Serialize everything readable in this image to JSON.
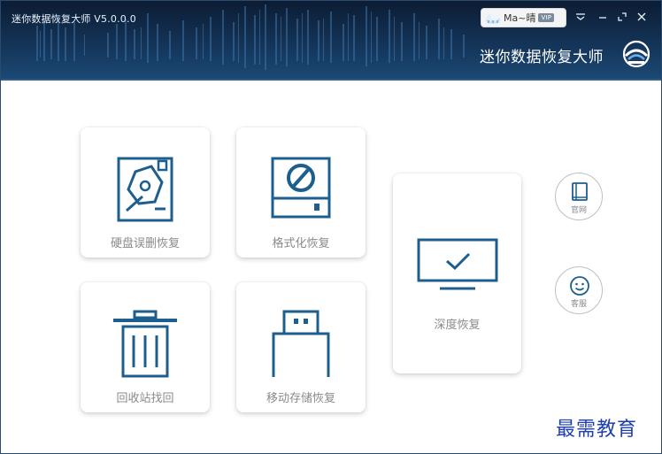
{
  "titlebar": {
    "app_title": "迷你数据恢复大师 V5.0.0.0",
    "user_name": "Ma~晴",
    "vip_label": "VIP",
    "brand_name": "迷你数据恢复大师"
  },
  "features": {
    "disk_delete": "硬盘误删恢复",
    "format": "格式化恢复",
    "deep": "深度恢复",
    "recycle": "回收站找回",
    "removable": "移动存储恢复"
  },
  "side": {
    "website": "官网",
    "service": "客服"
  },
  "watermark": "最需教育",
  "colors": {
    "header_dark": "#0c1c33",
    "header_mid": "#1c4a75",
    "icon_blue": "#1c5f8f",
    "label_gray": "#8a8a8a"
  },
  "icons": {
    "disk_delete": "hard-disk-icon",
    "format": "format-disk-icon",
    "deep": "monitor-check-icon",
    "recycle": "trash-bin-icon",
    "removable": "usb-drive-icon",
    "website": "book-icon",
    "service": "smiley-icon",
    "minimize": "minimize-icon",
    "maximize": "maximize-icon",
    "close": "close-icon",
    "menu": "chevron-down-icon"
  }
}
